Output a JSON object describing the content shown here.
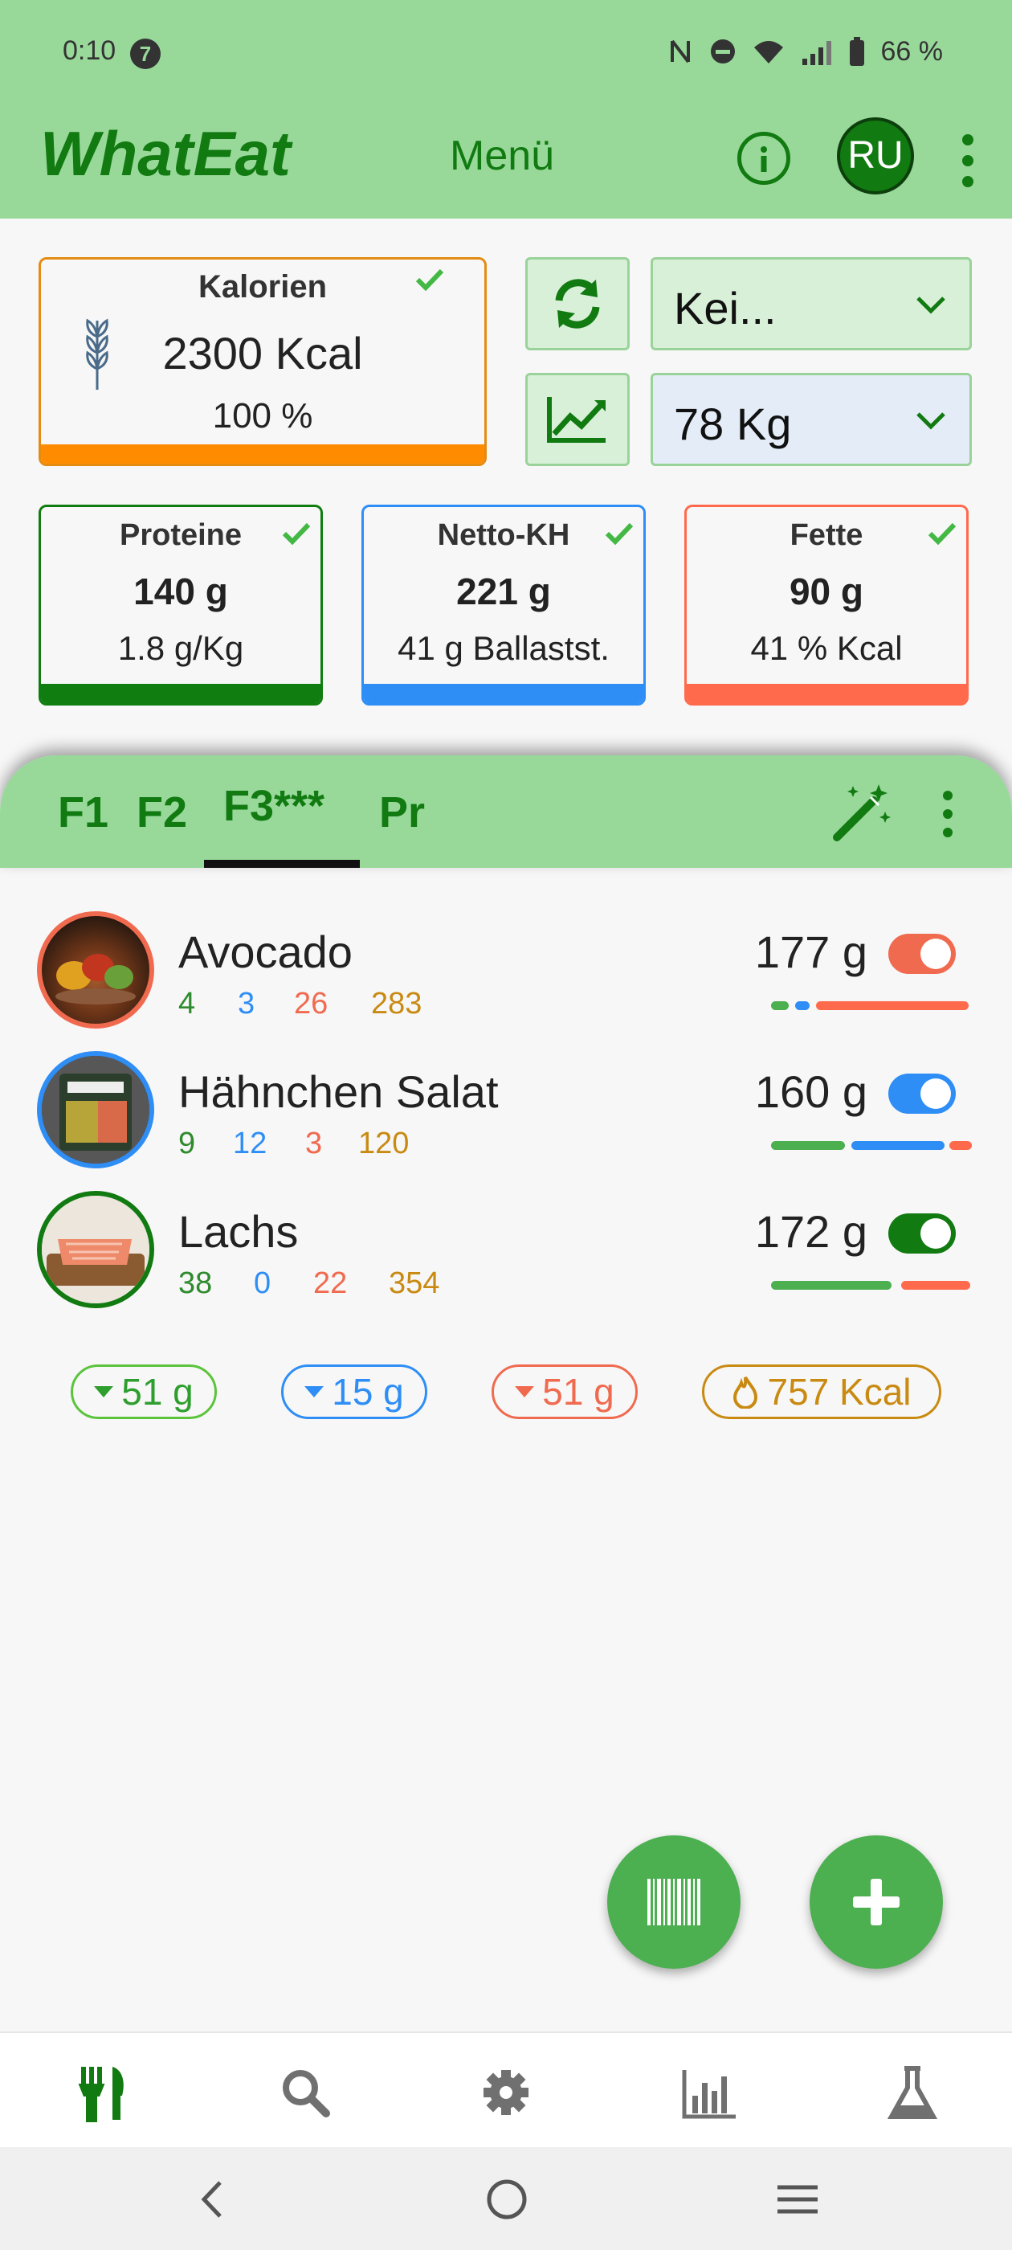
{
  "status_bar": {
    "time": "0:10",
    "notification_count": "7",
    "battery": "66 %"
  },
  "app": {
    "title": "WhatEat",
    "menu_label": "Menü",
    "avatar_initials": "RU"
  },
  "calories": {
    "label": "Kalorien",
    "value": "2300 Kcal",
    "percent": "100 %",
    "progress": 1.0
  },
  "diet_select": {
    "value": "Kei..."
  },
  "weight_select": {
    "value": "78 Kg"
  },
  "macros": [
    {
      "label": "Proteine",
      "value": "140 g",
      "sub": "1.8 g/Kg",
      "color": "#0f7d0f"
    },
    {
      "label": "Netto-KH",
      "value": "221 g",
      "sub": "41 g Ballastst.",
      "color": "#2e8ef5"
    },
    {
      "label": "Fette",
      "value": "90 g",
      "sub": "41 % Kcal",
      "color": "#ff6a4d"
    }
  ],
  "tabs": [
    {
      "label": "F1",
      "active": false
    },
    {
      "label": "F2",
      "active": false
    },
    {
      "label": "F3***",
      "active": true
    },
    {
      "label": "Pr",
      "active": false
    }
  ],
  "foods": [
    {
      "name": "Avocado",
      "protein": "4",
      "carbs": "3",
      "fat": "26",
      "kcal": "283",
      "amount": "177 g",
      "ring": "#f06a4f",
      "toggle_color": "#f06a4f",
      "enabled": true
    },
    {
      "name": "Hähnchen Salat",
      "protein": "9",
      "carbs": "12",
      "fat": "3",
      "kcal": "120",
      "amount": "160 g",
      "ring": "#2e8ef5",
      "toggle_color": "#2e8ef5",
      "enabled": true
    },
    {
      "name": "Lachs",
      "protein": "38",
      "carbs": "0",
      "fat": "22",
      "kcal": "354",
      "amount": "172 g",
      "ring": "#117a11",
      "toggle_color": "#117a11",
      "enabled": true
    }
  ],
  "summary": {
    "protein": "51 g",
    "carbs": "15 g",
    "fat": "51 g",
    "kcal": "757 Kcal"
  },
  "colors": {
    "brand_dark": "#117a11",
    "header": "#98d99a",
    "protein": "#4caf50",
    "carbs": "#2e8ef5",
    "fat": "#ff6a4d",
    "kcal": "#c98a12",
    "accent_orange": "#ff8c00"
  },
  "bottom_nav": [
    "fork-knife-icon",
    "search-icon",
    "gear-icon",
    "bar-chart-icon",
    "flask-icon"
  ]
}
